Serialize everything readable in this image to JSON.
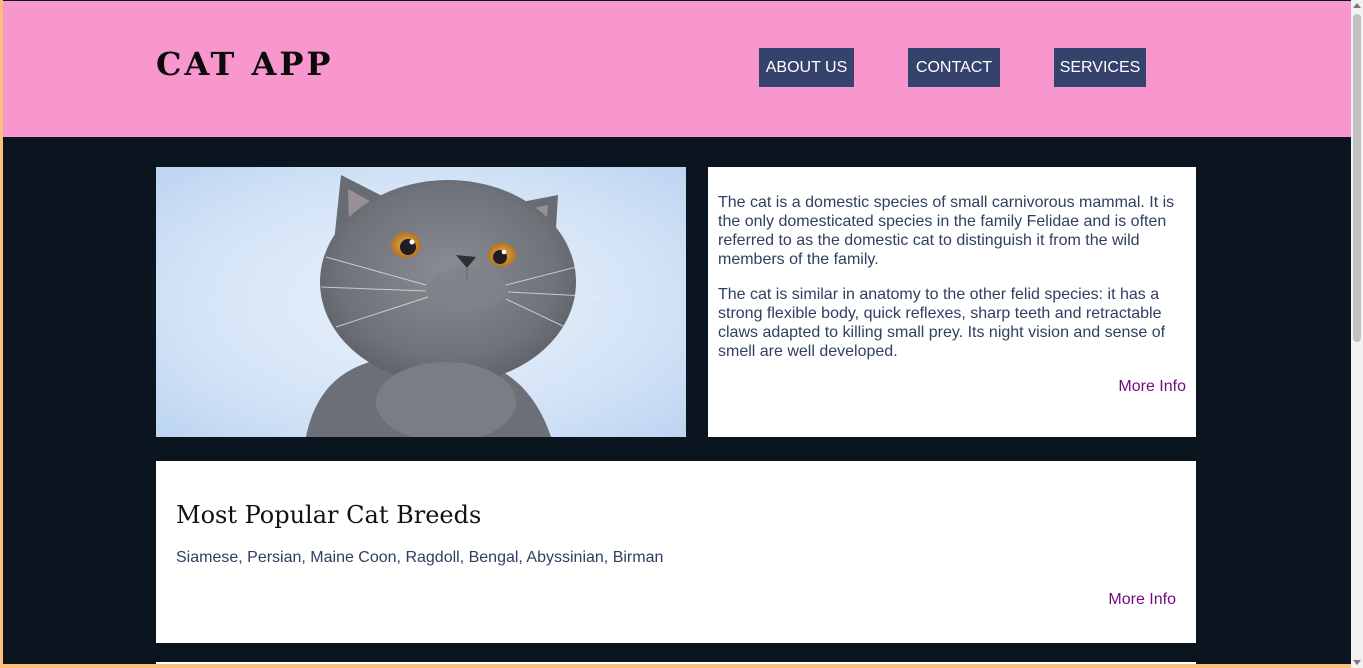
{
  "header": {
    "logo": "CAT APP",
    "nav": [
      {
        "label": "ABOUT US"
      },
      {
        "label": "CONTACT"
      },
      {
        "label": "SERVICES"
      }
    ]
  },
  "about_card": {
    "paragraph1": "The cat is a domestic species of small carnivorous mammal. It is the only domesticated species in the family Felidae and is often referred to as the domestic cat to distinguish it from the wild members of the family.",
    "paragraph2": "The cat is similar in anatomy to the other felid species: it has a strong flexible body, quick reflexes, sharp teeth and retractable claws adapted to killing small prey. Its night vision and sense of smell are well developed.",
    "link": "More Info"
  },
  "breeds_card": {
    "title": "Most Popular Cat Breeds",
    "list": "Siamese, Persian, Maine Coon, Ragdoll, Bengal, Abyssinian, Birman",
    "link": "More Info"
  },
  "colors": {
    "header_bg": "#f797ce",
    "page_bg": "#0b151f",
    "nav_button": "#35426b",
    "link": "#750a7d",
    "body_text": "#2e3f5f"
  },
  "icons": {
    "hero_image": "grey-cat-photo"
  }
}
